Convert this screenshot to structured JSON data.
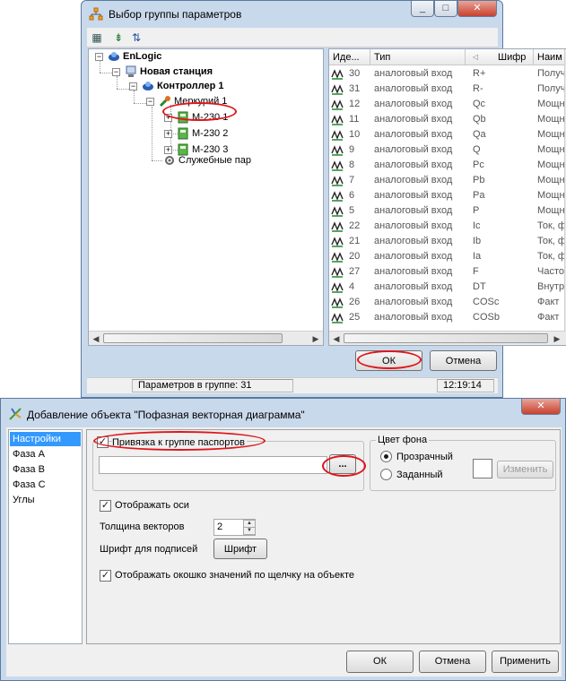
{
  "window1": {
    "title": "Выбор группы параметров",
    "caption_buttons": [
      "_",
      "□",
      "✕"
    ],
    "toolbar_icons": [
      "properties-icon",
      "import-icon",
      "sort-icon"
    ],
    "tree": {
      "root": "EnLogic",
      "station": "Новая станция",
      "controller": "Контроллер 1",
      "device": "Меркурий 1",
      "meters": [
        "М-230 1",
        "М-230 2",
        "М-230 3"
      ],
      "service": "Служебные пар"
    },
    "grid": {
      "headers": [
        "Иде...",
        "Тип",
        "Шифр",
        "Наим"
      ],
      "rows": [
        {
          "id": "30",
          "type": "аналоговый вход",
          "code": "R+",
          "name": "Получ"
        },
        {
          "id": "31",
          "type": "аналоговый вход",
          "code": "R-",
          "name": "Получ"
        },
        {
          "id": "12",
          "type": "аналоговый вход",
          "code": "Qc",
          "name": "Мощн"
        },
        {
          "id": "11",
          "type": "аналоговый вход",
          "code": "Qb",
          "name": "Мощн"
        },
        {
          "id": "10",
          "type": "аналоговый вход",
          "code": "Qa",
          "name": "Мощн"
        },
        {
          "id": "9",
          "type": "аналоговый вход",
          "code": "Q",
          "name": "Мощн"
        },
        {
          "id": "8",
          "type": "аналоговый вход",
          "code": "Pc",
          "name": "Мощн"
        },
        {
          "id": "7",
          "type": "аналоговый вход",
          "code": "Pb",
          "name": "Мощн"
        },
        {
          "id": "6",
          "type": "аналоговый вход",
          "code": "Pa",
          "name": "Мощн"
        },
        {
          "id": "5",
          "type": "аналоговый вход",
          "code": "P",
          "name": "Мощн"
        },
        {
          "id": "22",
          "type": "аналоговый вход",
          "code": "Ic",
          "name": "Ток, ф"
        },
        {
          "id": "21",
          "type": "аналоговый вход",
          "code": "Ib",
          "name": "Ток, ф"
        },
        {
          "id": "20",
          "type": "аналоговый вход",
          "code": "Ia",
          "name": "Ток, ф"
        },
        {
          "id": "27",
          "type": "аналоговый вход",
          "code": "F",
          "name": "Часто"
        },
        {
          "id": "4",
          "type": "аналоговый вход",
          "code": "DT",
          "name": "Внутр"
        },
        {
          "id": "26",
          "type": "аналоговый вход",
          "code": "COSc",
          "name": "Факт"
        },
        {
          "id": "25",
          "type": "аналоговый вход",
          "code": "COSb",
          "name": "Факт"
        }
      ]
    },
    "ok_label": "ОК",
    "cancel_label": "Отмена",
    "status_params": "Параметров в группе: 31",
    "status_time": "12:19:14"
  },
  "window2": {
    "title": "Добавление объекта \"Пофазная векторная диаграмма\"",
    "close_glyph": "✕",
    "nav": [
      "Настройки",
      "Фаза A",
      "Фаза B",
      "Фаза C",
      "Углы"
    ],
    "bind_passport_label": "Привязка к группе паспортов",
    "browse_label": "...",
    "bg_group_label": "Цвет фона",
    "transparent_label": "Прозрачный",
    "custom_label": "Заданный",
    "change_label": "Изменить",
    "show_axes_label": "Отображать оси",
    "vector_thickness_label": "Толщина векторов",
    "vector_thickness_value": "2",
    "font_label": "Шрифт для подписей",
    "font_button": "Шрифт",
    "show_values_label": "Отображать окошко значений по щелчку на объекте",
    "ok_label": "ОК",
    "cancel_label": "Отмена",
    "apply_label": "Применить",
    "checkmark": "✓"
  }
}
